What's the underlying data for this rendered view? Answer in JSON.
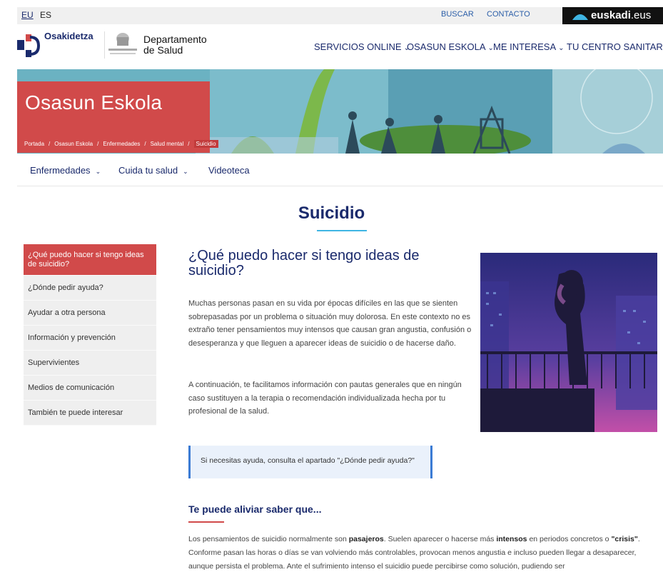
{
  "topbar": {
    "lang_eu": "EU",
    "lang_es": "ES",
    "buscar": "BUSCAR",
    "contacto": "CONTACTO",
    "euskadi_bold": "euskadi",
    "euskadi_suffix": ".eus"
  },
  "header": {
    "logo_name": "Osakidetza",
    "dept_line1": "Departamento",
    "dept_line2": "de Salud",
    "nav": [
      {
        "label": "SERVICIOS ONLINE"
      },
      {
        "label": "OSASUN ESKOLA"
      },
      {
        "label": "ME INTERESA"
      },
      {
        "label": "TU CENTRO SANITARIO"
      }
    ]
  },
  "banner": {
    "title": "Osasun Eskola",
    "breadcrumb": [
      "Portada",
      "Osasun Eskola",
      "Enfermedades",
      "Salud mental",
      "Suicidio"
    ]
  },
  "subnav": [
    {
      "label": "Enfermedades"
    },
    {
      "label": "Cuida tu salud"
    },
    {
      "label": "Videoteca"
    }
  ],
  "page": {
    "title": "Suicidio"
  },
  "sidebar": {
    "items": [
      {
        "label": "¿Qué puedo hacer si tengo ideas de suicidio?"
      },
      {
        "label": "¿Dónde pedir ayuda?"
      },
      {
        "label": "Ayudar a otra persona"
      },
      {
        "label": "Información y prevención"
      },
      {
        "label": "Supervivientes"
      },
      {
        "label": "Medios de comunicación"
      },
      {
        "label": "También te puede interesar"
      }
    ]
  },
  "content": {
    "heading": "¿Qué puedo hacer si tengo ideas de suicidio?",
    "p1": "Muchas personas pasan en su vida por épocas difíciles en las que se sienten sobrepasadas por un problema o situación muy dolorosa. En este contexto no es extraño tener pensamientos muy intensos que causan gran angustia, confusión o desesperanza y que lleguen a aparecer ideas de suicidio o de hacerse daño.",
    "p2": "A continuación, te facilitamos información con pautas generales que en ningún caso sustituyen a la terapia o recomendación individualizada hecha por tu profesional de la salud.",
    "callout": "Si necesitas ayuda, consulta el apartado \"¿Dónde pedir ayuda?\"",
    "subheading": "Te puede aliviar saber que...",
    "lp_1": "Los pensamientos de suicidio normalmente son ",
    "lp_b1": "pasajeros",
    "lp_2": ". Suelen aparecer o hacerse más ",
    "lp_b2": "intensos",
    "lp_3": " en periodos concretos o ",
    "lp_b3": "\"crisis\"",
    "lp_4": ". Conforme pasan las horas o días se van volviendo más controlables, provocan menos angustia e incluso pueden llegar a desaparecer, aunque persista el problema. Ante el sufrimiento intenso el suicidio puede percibirse como solución, pudiendo ser"
  },
  "colors": {
    "brand_blue": "#1a2a6c",
    "accent_red": "#d14a4a",
    "accent_cyan": "#3fb5e3",
    "callout_border": "#3b7bd4"
  }
}
